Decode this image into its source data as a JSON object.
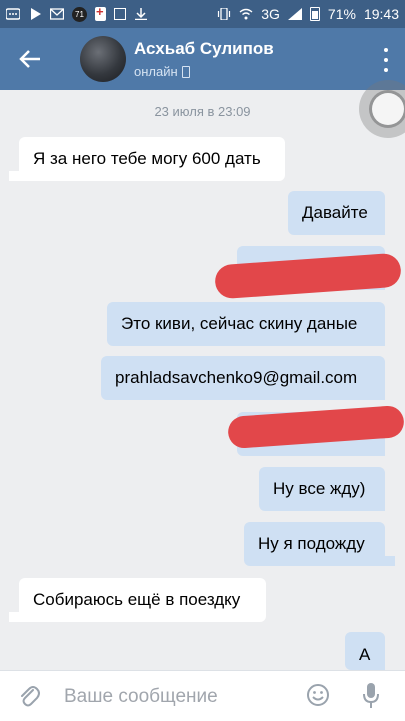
{
  "statusbar": {
    "notification_badge": "71",
    "network": "3G",
    "battery": "71%",
    "time": "19:43"
  },
  "header": {
    "name": "Асхьаб Сулипов",
    "status": "онлайн"
  },
  "chat": {
    "date": "23 июля в 23:09",
    "messages": [
      {
        "dir": "in",
        "text": "Я за него тебе могу 600 дать"
      },
      {
        "dir": "out",
        "text": "Давайте"
      },
      {
        "dir": "out",
        "text": "",
        "redacted": true
      },
      {
        "dir": "out",
        "text": "Это киви, сейчас скину даные"
      },
      {
        "dir": "out",
        "text": "prahladsavchenko9@gmail.com"
      },
      {
        "dir": "out",
        "text": "",
        "redacted": true
      },
      {
        "dir": "out",
        "text": "Ну все жду)"
      },
      {
        "dir": "out",
        "text": "Ну я подожду"
      },
      {
        "dir": "in",
        "text": "Собираюсь ещё в поездку"
      },
      {
        "dir": "out",
        "text": "А"
      }
    ]
  },
  "composer": {
    "placeholder": "Ваше сообщение"
  },
  "colors": {
    "header": "#4f79a8",
    "statusbar": "#3d5f86",
    "outgoing_bubble": "#cfe0f3",
    "incoming_bubble": "#ffffff",
    "background": "#edeef0",
    "redaction": "#e2474a"
  }
}
